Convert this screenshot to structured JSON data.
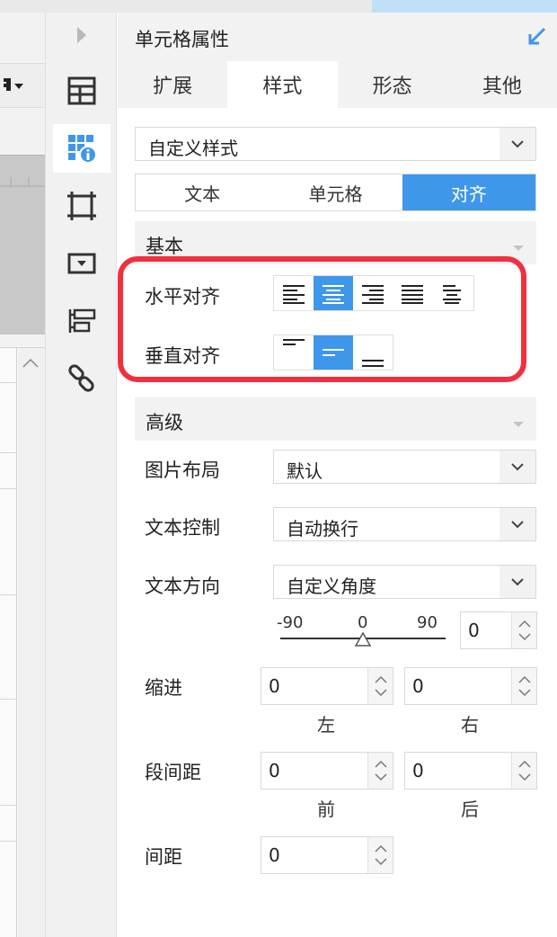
{
  "panel": {
    "title": "单元格属性"
  },
  "tabs": [
    {
      "label": "扩展"
    },
    {
      "label": "样式"
    },
    {
      "label": "形态"
    },
    {
      "label": "其他"
    }
  ],
  "style_select": {
    "value": "自定义样式"
  },
  "subtabs": [
    {
      "label": "文本"
    },
    {
      "label": "单元格"
    },
    {
      "label": "对齐"
    }
  ],
  "basic": {
    "title": "基本",
    "horizontal_label": "水平对齐",
    "vertical_label": "垂直对齐"
  },
  "advanced": {
    "title": "高级",
    "image_layout_label": "图片布局",
    "image_layout_value": "默认",
    "text_control_label": "文本控制",
    "text_control_value": "自动换行",
    "text_direction_label": "文本方向",
    "text_direction_value": "自定义角度",
    "angle_ticks": [
      "-90",
      "0",
      "90"
    ],
    "angle_value": "0",
    "indent_label": "缩进",
    "indent_left": "0",
    "indent_right": "0",
    "indent_left_label": "左",
    "indent_right_label": "右",
    "para_spacing_label": "段间距",
    "para_before": "0",
    "para_after": "0",
    "para_before_label": "前",
    "para_after_label": "后",
    "spacing_label": "间距",
    "spacing_value": "0"
  },
  "colors": {
    "accent": "#3e97ea",
    "highlight": "#f03040"
  }
}
